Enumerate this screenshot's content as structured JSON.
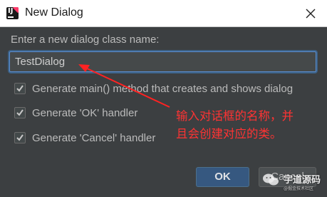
{
  "window": {
    "title": "New Dialog",
    "app_icon": "intellij-icon",
    "close_icon": "close-icon"
  },
  "form": {
    "prompt_label": "Enter a new dialog class name:",
    "class_name_value": "TestDialog",
    "options": [
      {
        "label": "Generate main() method that creates and shows dialog",
        "checked": true
      },
      {
        "label": "Generate 'OK' handler",
        "checked": true
      },
      {
        "label": "Generate 'Cancel' handler",
        "checked": true
      }
    ]
  },
  "annotation": {
    "line1": "输入对话框的名称，并",
    "line2": "且会创建对应的类。",
    "color": "#ff3333"
  },
  "buttons": {
    "ok_label": "OK",
    "cancel_label": "Cancel"
  },
  "watermark": {
    "title": "宇道源码",
    "subtitle": "@掘金技术社区"
  },
  "colors": {
    "background": "#3c3f41",
    "accent": "#365880",
    "focus_border": "#5b8fd2"
  }
}
